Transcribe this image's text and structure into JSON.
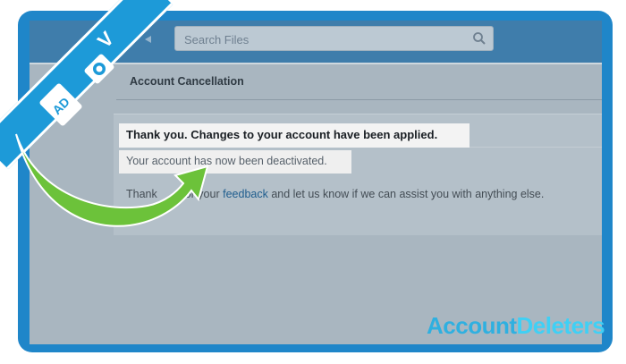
{
  "search": {
    "placeholder": "Search Files"
  },
  "page": {
    "title": "Account Cancellation"
  },
  "messages": {
    "confirmation": "Thank you. Changes to your account have been applied.",
    "deactivated": "Your account has now been deactivated.",
    "thanks_prefix": "Thank",
    "thanks_mid": "or your",
    "feedback_link": "feedback",
    "thanks_suffix": "and let us know if we can assist you with anything else."
  },
  "brand": {
    "part1": "Account",
    "part2": "Deleters"
  },
  "ribbon": {
    "letter": "V",
    "badge": "AD"
  },
  "colors": {
    "frame": "#1f86c9",
    "header": "#3f7dab",
    "arrow": "#6cc23a",
    "ribbon": "#1d9ad8"
  },
  "icons": [
    "search-icon",
    "camera-icon",
    "sd-card-icon",
    "arrow-icon"
  ]
}
